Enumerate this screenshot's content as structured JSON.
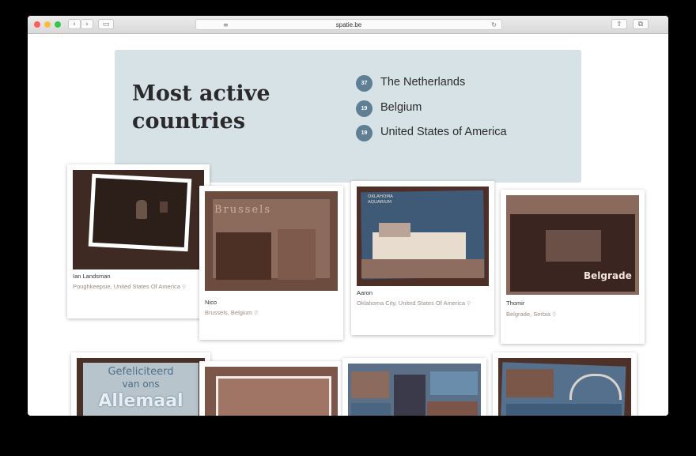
{
  "browser": {
    "url": "spatie.be",
    "traffic_lights": [
      "#fc605c",
      "#fdbc40",
      "#34c84a"
    ],
    "back_icon": "‹",
    "forward_icon": "›",
    "sidebar_icon": "▭",
    "info_icon": "ⓘ",
    "reader_icon": "≡",
    "reload_icon": "↻",
    "share_icon": "⇧",
    "tabs_icon": "⧉"
  },
  "banner": {
    "title": "Most active countries",
    "countries": [
      {
        "count": "37",
        "name": "The Netherlands"
      },
      {
        "count": "19",
        "name": "Belgium"
      },
      {
        "count": "19",
        "name": "United States of America"
      }
    ]
  },
  "postcards_row1": [
    {
      "name": "Ian Landsman",
      "location": "Poughkeepsie, United States Of America"
    },
    {
      "name": "Nico",
      "location": "Brussels, Belgium"
    },
    {
      "name": "Aaron",
      "location": "Oklahoma City, United States Of America"
    },
    {
      "name": "Thomir",
      "location": "Belgrade, Serbia"
    }
  ],
  "postcard_text": {
    "brussels": "Brussels",
    "oklahoma": "OKLAHOMA AQUARIUM",
    "belgrade": "Belgrade",
    "greeting_line1": "Gefeliciteerd",
    "greeting_line2": "van ons",
    "greeting_line3": "Allemaal"
  },
  "pin_icon": "⚲",
  "colors": {
    "banner_bg": "#d7e2e7",
    "badge": "#5e7f94",
    "location_text": "#9a8d82"
  }
}
